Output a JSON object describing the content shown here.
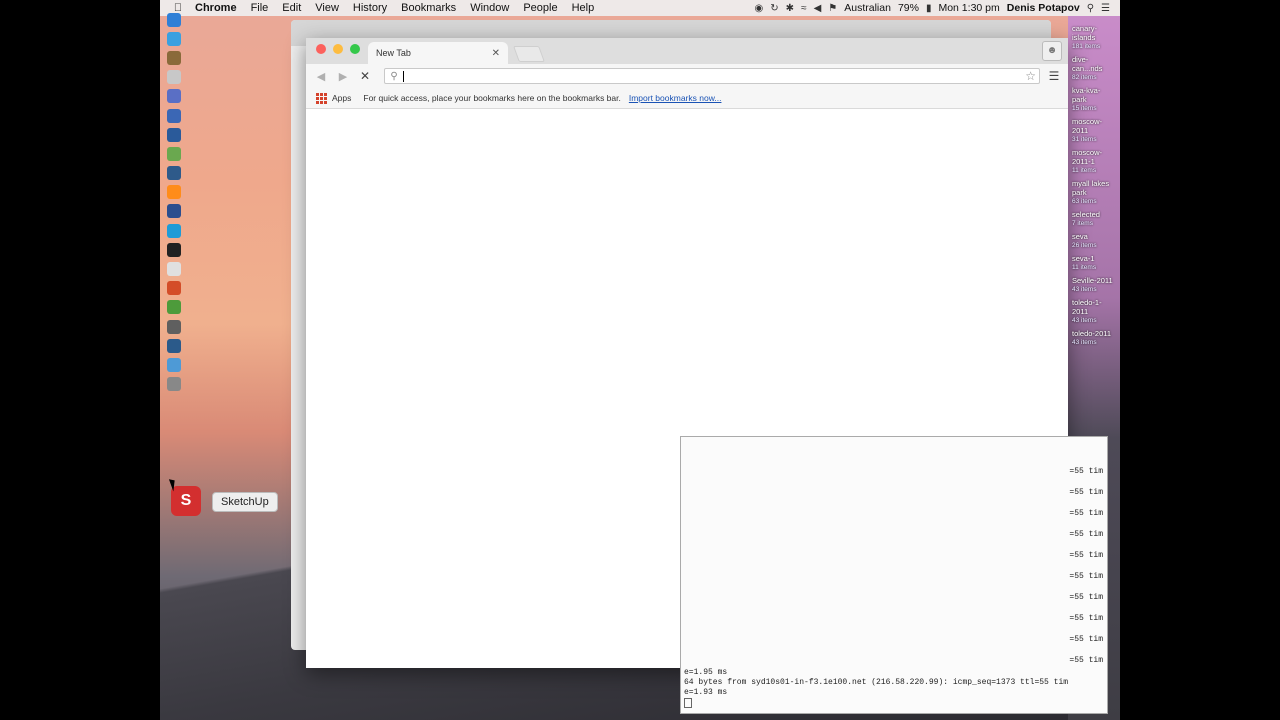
{
  "menubar": {
    "app": "Chrome",
    "items": [
      "File",
      "Edit",
      "View",
      "History",
      "Bookmarks",
      "Window",
      "People",
      "Help"
    ],
    "input_source": "Australian",
    "battery": "79%",
    "time": "Mon 1:30 pm",
    "user": "Denis Potapov"
  },
  "dock": {
    "tooltip": "SketchUp",
    "icon_colors": [
      "#2f7fd6",
      "#3aa0e0",
      "#8a6a3a",
      "#c8c8c8",
      "#5a6fc5",
      "#3b67b5",
      "#2a5a9a",
      "#6aa84f",
      "#2e5a8a",
      "#ff8c1a",
      "#2b4e8e",
      "#1e9bd7",
      "#222222",
      "#e0e0e0",
      "#d44d28",
      "#4d9b3b",
      "#5f5f5f",
      "#2b5a8a",
      "#4e9ad6",
      "#888888"
    ]
  },
  "chrome": {
    "tab_title": "New Tab",
    "omnibox_value": "",
    "bookmarks_apps": "Apps",
    "bookmarks_hint": "For quick access, place your bookmarks here on the bookmarks bar.",
    "bookmarks_import": "Import bookmarks now..."
  },
  "desktop_items": [
    {
      "name": "canary-islands",
      "count": "181 items"
    },
    {
      "name": "dive-can...nds",
      "count": "82 items"
    },
    {
      "name": "kva-kva-park",
      "count": "15 items"
    },
    {
      "name": "moscow-2011",
      "count": "31 items"
    },
    {
      "name": "moscow-2011-1",
      "count": "11 items"
    },
    {
      "name": "myall lakes park",
      "count": "63 items"
    },
    {
      "name": "selected",
      "count": "7 items"
    },
    {
      "name": "seva",
      "count": "26 items"
    },
    {
      "name": "seva-1",
      "count": "11 items"
    },
    {
      "name": "Seville-2011",
      "count": "43 items"
    },
    {
      "name": "toledo-1-2011",
      "count": "43 items"
    },
    {
      "name": "toledo-2011",
      "count": "43 items"
    }
  ],
  "terminal": {
    "ttl_lines": [
      "=55 tim",
      "=55 tim",
      "=55 tim",
      "=55 tim",
      "=55 tim",
      "=55 tim",
      "=55 tim",
      "=55 tim",
      "=55 tim",
      "=55 tim"
    ],
    "line1": "e=1.95 ms",
    "line2": "64 bytes from syd10s01-in-f3.1e100.net (216.58.220.99): icmp_seq=1373 ttl=55 tim",
    "line3": "e=1.93 ms"
  }
}
